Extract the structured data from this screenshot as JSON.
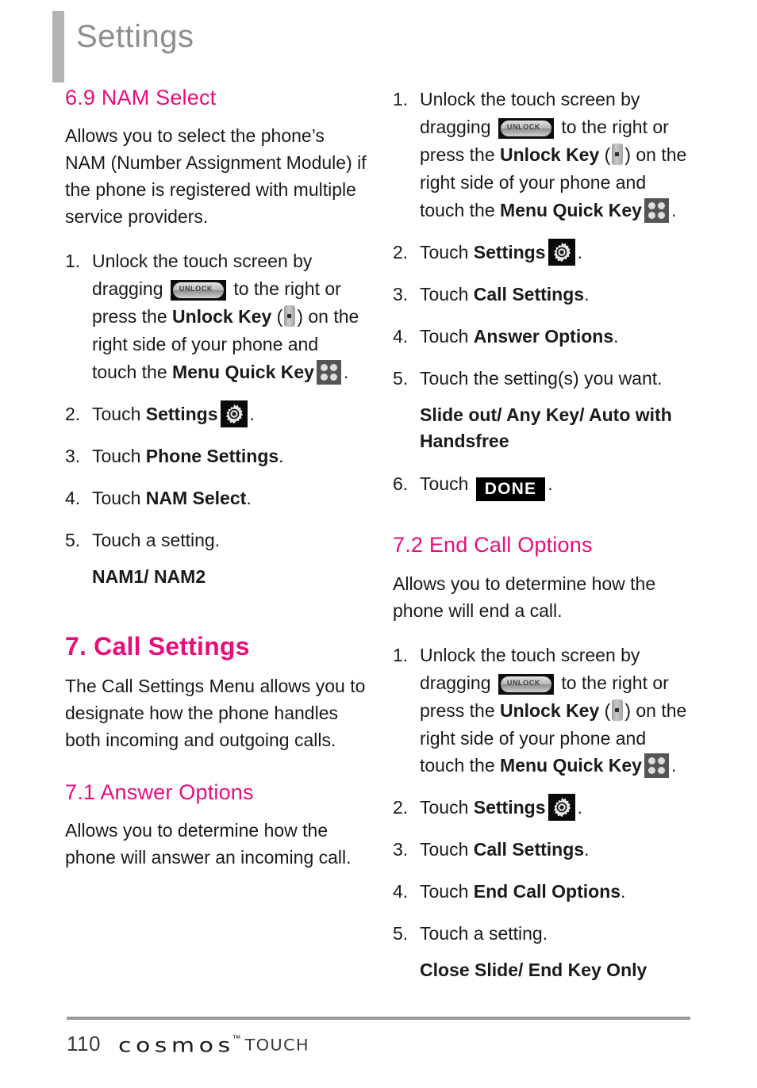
{
  "header": {
    "title": "Settings"
  },
  "icons": {
    "unlock_label": "UNLOCK",
    "unlock_slider": "unlock-slider-icon",
    "side_key": "unlock-side-key-icon",
    "menu_quick_key": "menu-quick-key-icon",
    "settings_gear": "settings-gear-icon"
  },
  "left_column": {
    "section": {
      "heading": "6.9 NAM Select",
      "intro": "Allows you to select the phone’s NAM (Number Assignment Module) if the phone is registered with multiple service providers.",
      "steps": [
        {
          "num": "1.",
          "parts": {
            "t1": "Unlock the touch screen by dragging",
            "t2": "to the right or press the",
            "bold1": "Unlock Key",
            "t3": "(",
            "t4": ") on the right side of your phone and touch the",
            "bold2": "Menu Quick Key",
            "t5": "."
          }
        },
        {
          "num": "2.",
          "parts": {
            "t1": "Touch",
            "bold1": "Settings",
            "t5": "."
          }
        },
        {
          "num": "3.",
          "parts": {
            "t1": "Touch",
            "bold1": "Phone Settings",
            "t5": "."
          }
        },
        {
          "num": "4.",
          "parts": {
            "t1": "Touch",
            "bold1": "NAM Select",
            "t5": "."
          }
        },
        {
          "num": "5.",
          "parts": {
            "t1": "Touch a setting."
          }
        }
      ],
      "options": "NAM1/ NAM2"
    },
    "chapter": {
      "heading": "7. Call Settings",
      "intro": "The Call Settings Menu allows you to designate how the phone handles both incoming and outgoing calls."
    },
    "subsection": {
      "heading": "7.1 Answer Options",
      "intro": "Allows you to determine how the phone will answer an incoming call."
    }
  },
  "right_column": {
    "answer_options_steps": [
      {
        "num": "1.",
        "parts": {
          "t1": "Unlock the touch screen by dragging",
          "t2": "to the right or press the",
          "bold1": "Unlock Key",
          "t3": "(",
          "t4": ") on the right side of your phone and touch the",
          "bold2": "Menu Quick Key",
          "t5": "."
        }
      },
      {
        "num": "2.",
        "parts": {
          "t1": "Touch",
          "bold1": "Settings",
          "t5": "."
        }
      },
      {
        "num": "3.",
        "parts": {
          "t1": "Touch",
          "bold1": "Call Settings",
          "t5": "."
        }
      },
      {
        "num": "4.",
        "parts": {
          "t1": "Touch",
          "bold1": "Answer Options",
          "t5": "."
        }
      },
      {
        "num": "5.",
        "parts": {
          "t1": "Touch the setting(s) you want."
        }
      },
      {
        "num": "6.",
        "parts": {
          "t1": "Touch",
          "button": "DONE",
          "t5": "."
        }
      }
    ],
    "answer_options_values": "Slide out/ Any Key/ Auto with Handsfree",
    "end_call": {
      "heading": "7.2 End Call Options",
      "intro": "Allows you to determine how the phone will end a call.",
      "steps": [
        {
          "num": "1.",
          "parts": {
            "t1": "Unlock the touch screen by dragging",
            "t2": "to the right or press the",
            "bold1": "Unlock Key",
            "t3": "(",
            "t4": ") on the right side of your phone and touch the",
            "bold2": "Menu Quick Key",
            "t5": "."
          }
        },
        {
          "num": "2.",
          "parts": {
            "t1": "Touch",
            "bold1": "Settings",
            "t5": "."
          }
        },
        {
          "num": "3.",
          "parts": {
            "t1": "Touch",
            "bold1": "Call Settings",
            "t5": "."
          }
        },
        {
          "num": "4.",
          "parts": {
            "t1": "Touch",
            "bold1": "End Call Options",
            "t5": "."
          }
        },
        {
          "num": "5.",
          "parts": {
            "t1": "Touch a setting."
          }
        }
      ],
      "options": "Close Slide/ End Key Only"
    }
  },
  "footer": {
    "page_number": "110",
    "brand": "cosmos",
    "trademark": "™",
    "product": "TOUCH"
  },
  "colors": {
    "accent_magenta": "#ea0c7b",
    "header_gray": "#8e8e8e",
    "rule_gray": "#9a9a9a",
    "body_text": "#1a1a1a"
  }
}
